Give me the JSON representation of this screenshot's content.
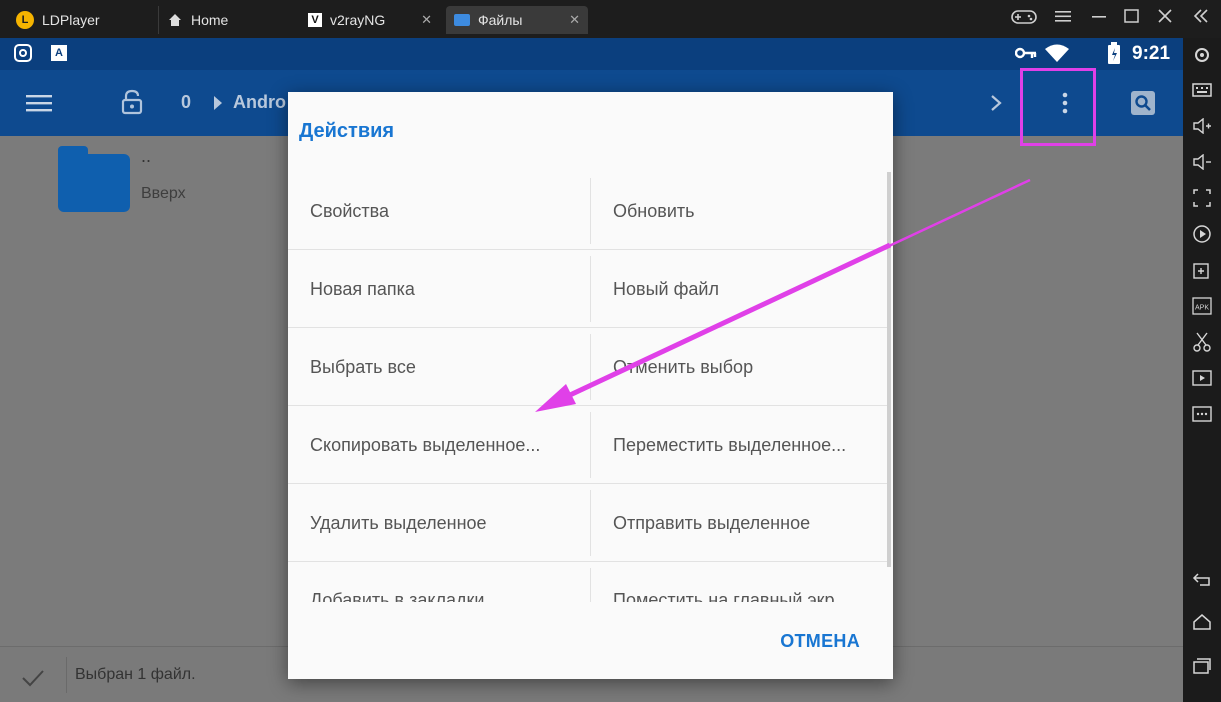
{
  "titlebar": {
    "app_name": "LDPlayer",
    "tabs": [
      {
        "label": "Home",
        "icon": "home-icon"
      },
      {
        "label": "v2rayNG",
        "icon": "v2ray-icon"
      },
      {
        "label": "Файлы",
        "icon": "folder-icon"
      }
    ],
    "close_glyph": "✕"
  },
  "statusbar": {
    "time": "9:21"
  },
  "appbar": {
    "path_root": "0",
    "path_segment": "Andro"
  },
  "file_list": {
    "items": [
      {
        "name": "..",
        "subtitle": "Вверх"
      }
    ]
  },
  "bottom": {
    "selection_status": "Выбран 1 файл."
  },
  "dialog": {
    "title": "Действия",
    "actions": [
      [
        "Свойства",
        "Обновить"
      ],
      [
        "Новая папка",
        "Новый файл"
      ],
      [
        "Выбрать все",
        "Отменить выбор"
      ],
      [
        "Скопировать выделенное...",
        "Переместить выделенное..."
      ],
      [
        "Удалить выделенное",
        "Отправить выделенное"
      ],
      [
        "Добавить в закладки",
        "Поместить на главный экр..."
      ]
    ],
    "cancel_label": "ОТМЕНА"
  },
  "colors": {
    "accent": "#1976d2",
    "annotation": "#e040e8",
    "appbar": "#0e4a8f"
  }
}
